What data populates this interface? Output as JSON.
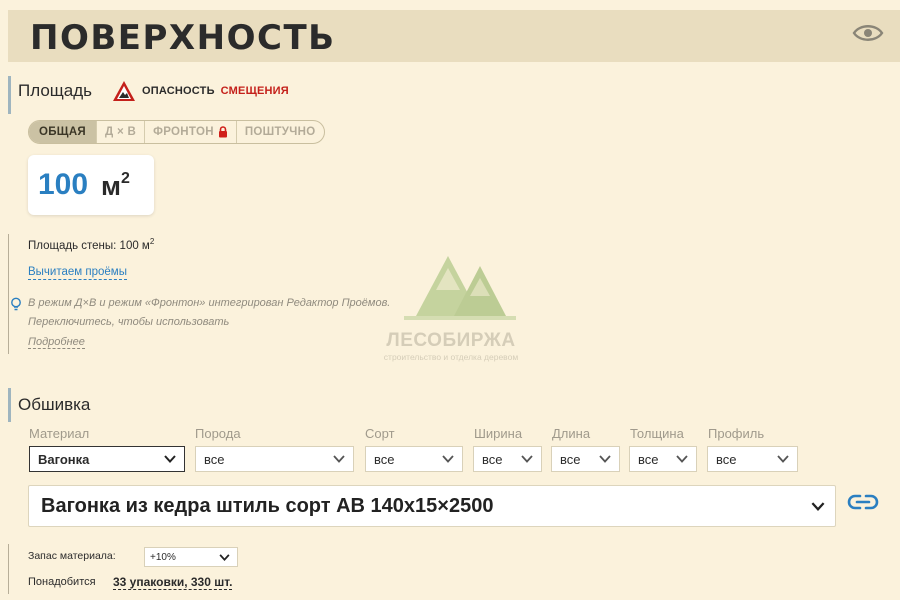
{
  "header": {
    "title": "ПОВЕРХНОСТЬ",
    "visibility_icon": "eye-icon"
  },
  "area": {
    "label": "Площадь",
    "warning": {
      "icon": "warning-triangle-icon",
      "text_a": "ОПАСНОСТЬ",
      "text_b": "СМЕЩЕНИЯ"
    },
    "modes": [
      {
        "label": "ОБЩАЯ",
        "active": true
      },
      {
        "label": "Д × В",
        "active": false
      },
      {
        "label": "ФРОНТОН",
        "active": false,
        "locked": true
      },
      {
        "label": "ПОШТУЧНО",
        "active": false
      }
    ],
    "value": "100",
    "unit": "м",
    "unit_power": "2",
    "wall_area_text": "Площадь стены: 100 м",
    "wall_area_power": "2",
    "subtract_link": "Вычитаем проёмы",
    "hint_line1": "В режим Д×В и режим «Фронтон» интегрирован Редактор Проёмов.",
    "hint_line2": "Переключитесь, чтобы использовать",
    "hint_more": "Подробнее"
  },
  "watermark": {
    "name": "ЛЕСОБИРЖА",
    "tagline": "строительство и отделка деревом"
  },
  "cladding": {
    "label": "Обшивка",
    "filters": [
      {
        "label": "Материал",
        "value": "Вагонка"
      },
      {
        "label": "Порода",
        "value": "все"
      },
      {
        "label": "Сорт",
        "value": "все"
      },
      {
        "label": "Ширина",
        "value": "все"
      },
      {
        "label": "Длина",
        "value": "все"
      },
      {
        "label": "Толщина",
        "value": "все"
      },
      {
        "label": "Профиль",
        "value": "все"
      }
    ],
    "product": "Вагонка из кедра штиль сорт АВ 140х15×2500",
    "reserve_label": "Запас материала:",
    "reserve_value": "+10%",
    "need_label": "Понадобится",
    "need_value": "33 упаковки, 330 шт."
  },
  "colors": {
    "accent": "#2a7fc1",
    "danger": "#c4201a",
    "header_bg": "#e9ddbf",
    "page_bg": "#fbf2dc"
  }
}
